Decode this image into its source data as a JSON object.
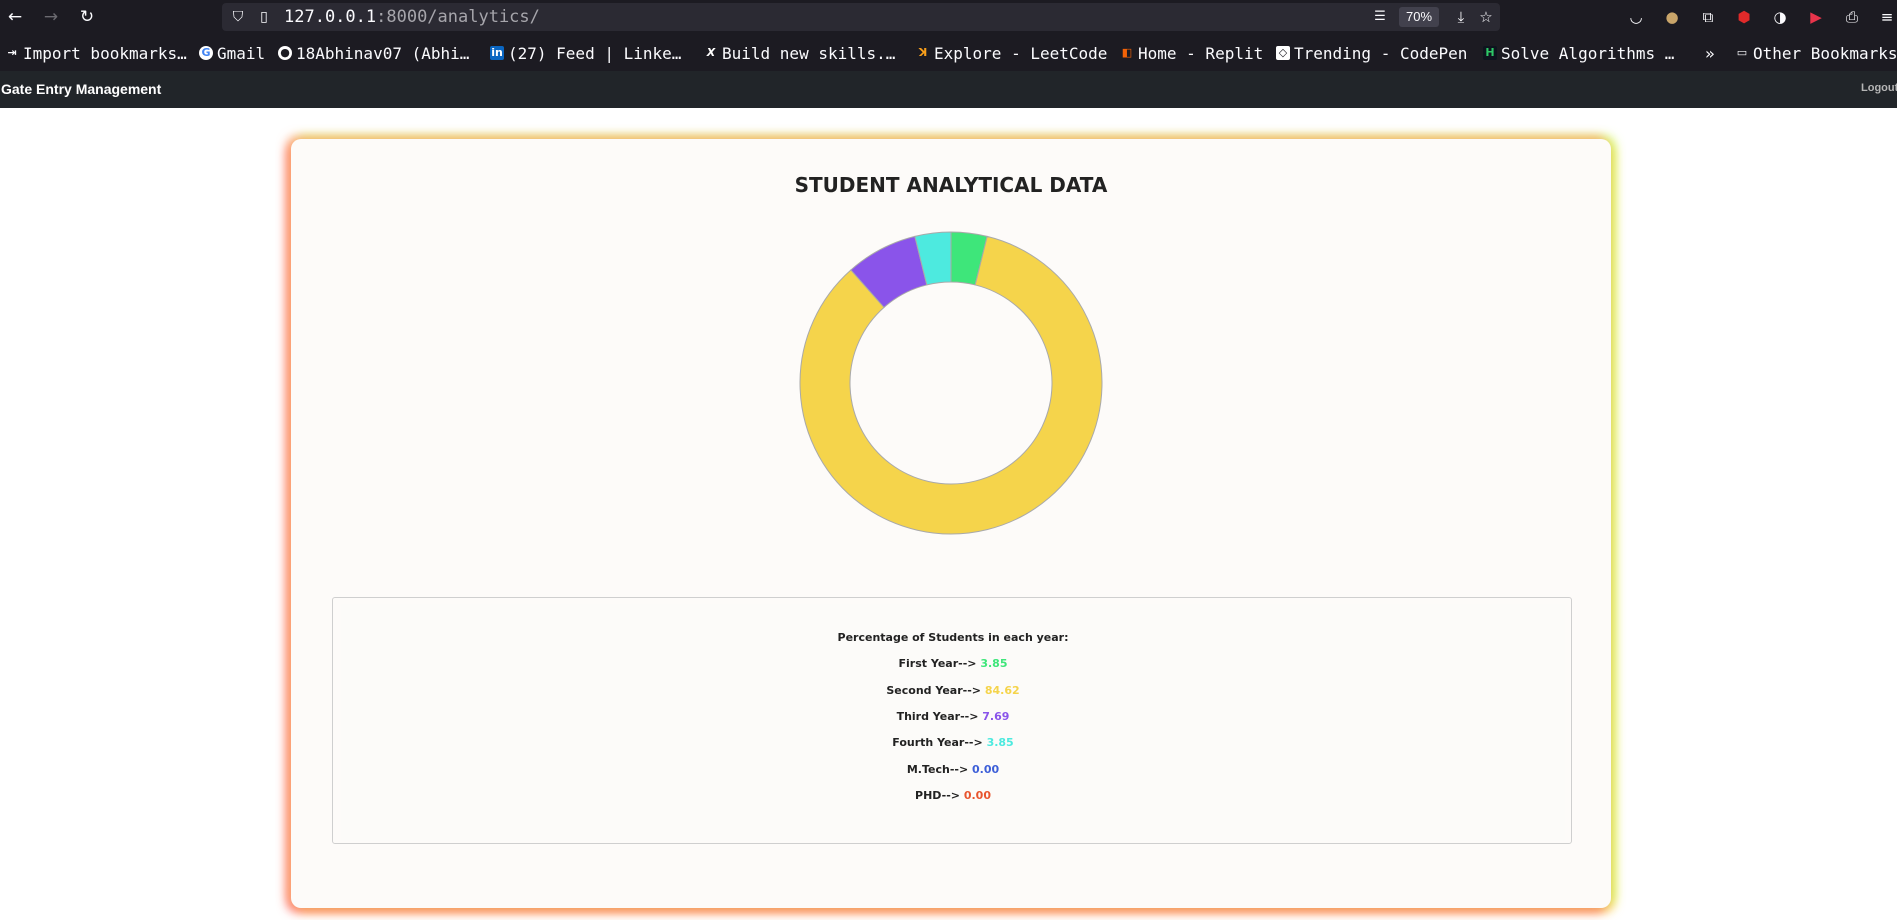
{
  "browser": {
    "url_host": "127.0.0.1",
    "url_rest": ":8000/analytics/",
    "zoom": "70%"
  },
  "bookmarks": [
    {
      "label": "Import bookmarks…",
      "icon": "import-icon"
    },
    {
      "label": "Gmail",
      "icon": "google-icon"
    },
    {
      "label": "18Abhinav07 (Abhi…",
      "icon": "github-icon"
    },
    {
      "label": "(27) Feed | Linke…",
      "icon": "linkedin-icon"
    },
    {
      "label": "Build new skills.…",
      "icon": "x-icon"
    },
    {
      "label": "Explore - LeetCode",
      "icon": "leetcode-icon"
    },
    {
      "label": "Home - Replit",
      "icon": "replit-icon"
    },
    {
      "label": "Trending - CodePen",
      "icon": "codepen-icon"
    },
    {
      "label": "Solve Algorithms …",
      "icon": "hackerrank-icon"
    }
  ],
  "other_bookmarks": "Other Bookmarks",
  "app": {
    "brand": "Gate Entry Management",
    "logout": "Logout"
  },
  "page": {
    "title": "STUDENT ANALYTICAL DATA",
    "stats_heading": "Percentage of Students in each year:",
    "stats": [
      {
        "label": "First Year-->",
        "value": "3.85",
        "color": "#3ee67a"
      },
      {
        "label": "Second Year-->",
        "value": "84.62",
        "color": "#f5d44b"
      },
      {
        "label": "Third Year-->",
        "value": "7.69",
        "color": "#8a54ea"
      },
      {
        "label": "Fourth Year-->",
        "value": "3.85",
        "color": "#4deadf"
      },
      {
        "label": "M.Tech-->",
        "value": "0.00",
        "color": "#3d5fd8"
      },
      {
        "label": "PHD-->",
        "value": "0.00",
        "color": "#e8552e"
      }
    ]
  },
  "chart_data": {
    "type": "pie",
    "categories": [
      "First Year",
      "Second Year",
      "Third Year",
      "Fourth Year",
      "M.Tech",
      "PHD"
    ],
    "values": [
      3.85,
      84.62,
      7.69,
      3.85,
      0.0,
      0.0
    ],
    "colors": [
      "#3ee67a",
      "#f5d44b",
      "#8a54ea",
      "#4deadf",
      "#3d5fd8",
      "#e8552e"
    ],
    "donut": true
  }
}
